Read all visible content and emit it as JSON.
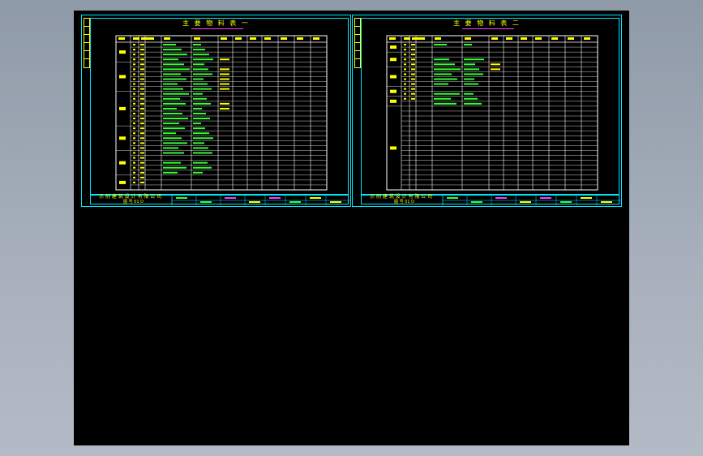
{
  "sheets": [
    {
      "title": "主 要 物 料 表 一",
      "company": "示 例 建 筑 设 计 有 限 公 司",
      "drawing_no": "图 号 01 D",
      "row_count": 30
    },
    {
      "title": "主 要 物 料 表 二",
      "company": "示 例 建 筑 设 计 有 限 公 司",
      "drawing_no": "图 号 01 D",
      "row_count": 30
    }
  ],
  "colors": {
    "background": "#000000",
    "frame": "#00e5ff",
    "text_yellow": "#ffff00",
    "text_green": "#33ff33",
    "table_lines": "#ffffff",
    "accent_magenta": "#ff3cff"
  }
}
